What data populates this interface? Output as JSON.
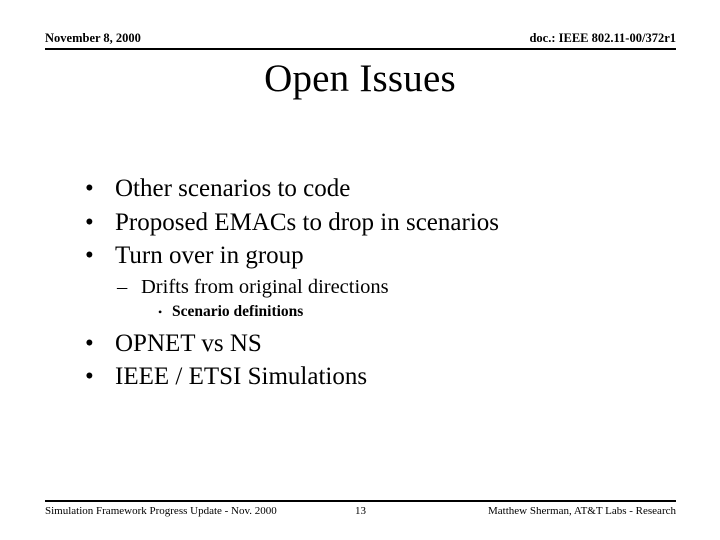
{
  "slide": {
    "header": {
      "date": "November 8, 2000",
      "doc_reference": "doc.: IEEE 802.11-00/372r1"
    },
    "title": "Open Issues",
    "bullets": [
      {
        "level": 1,
        "marker": "•",
        "text": "Other scenarios to code"
      },
      {
        "level": 1,
        "marker": "•",
        "text": "Proposed EMACs to drop in scenarios"
      },
      {
        "level": 1,
        "marker": "•",
        "text": "Turn over in group"
      },
      {
        "level": 2,
        "marker": "–",
        "text": "Drifts from original directions"
      },
      {
        "level": 3,
        "marker": "•",
        "text": "Scenario definitions"
      },
      {
        "level": 1,
        "marker": "•",
        "text": "OPNET vs NS"
      },
      {
        "level": 1,
        "marker": "•",
        "text": "IEEE / ETSI Simulations"
      }
    ],
    "footer": {
      "left": "Simulation Framework Progress Update - Nov. 2000",
      "page_number": "13",
      "right": "Matthew Sherman, AT&T Labs - Research"
    },
    "colors": {
      "background": "#ffffff",
      "text": "#000000",
      "rule": "#000000"
    }
  }
}
